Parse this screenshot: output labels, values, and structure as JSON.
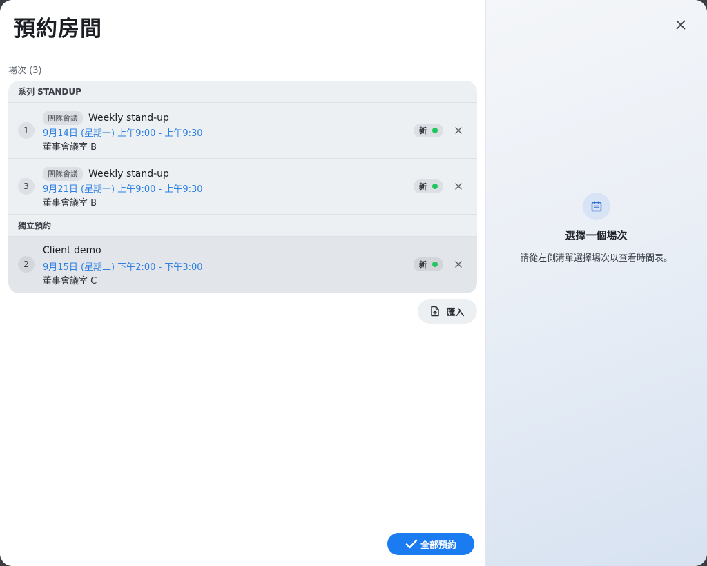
{
  "header": {
    "title": "預約房間"
  },
  "occurrences": {
    "label": "場次 (3)",
    "groups": [
      {
        "label": "系列 STANDUP",
        "items": [
          {
            "num": "1",
            "tag": "團隊會議",
            "title": "Weekly stand-up",
            "time": "9月14日 (星期一) 上午9:00 - 上午9:30",
            "room": "董事會議室 B",
            "status": "新"
          },
          {
            "num": "3",
            "tag": "團隊會議",
            "title": "Weekly stand-up",
            "time": "9月21日 (星期一) 上午9:00 - 上午9:30",
            "room": "董事會議室 B",
            "status": "新"
          }
        ]
      },
      {
        "label": "獨立預約",
        "items": [
          {
            "num": "2",
            "title": "Client demo",
            "time": "9月15日 (星期二) 下午2:00 - 下午3:00",
            "room": "董事會議室 C",
            "status": "新"
          }
        ]
      }
    ]
  },
  "actions": {
    "import_label": "匯入",
    "book_all_label": "全部預約"
  },
  "detail": {
    "empty_title": "選擇一個場次",
    "empty_subtitle": "請從左側清單選擇場次以查看時間表。"
  },
  "colors": {
    "accent": "#1a7cf0",
    "time_text": "#2d7fe2",
    "status_dot": "#22c55e"
  },
  "icons": {
    "close": "close-icon",
    "remove": "close-icon",
    "import": "file-upload-icon",
    "book_all": "checkmark-icon",
    "empty": "calendar-icon"
  }
}
